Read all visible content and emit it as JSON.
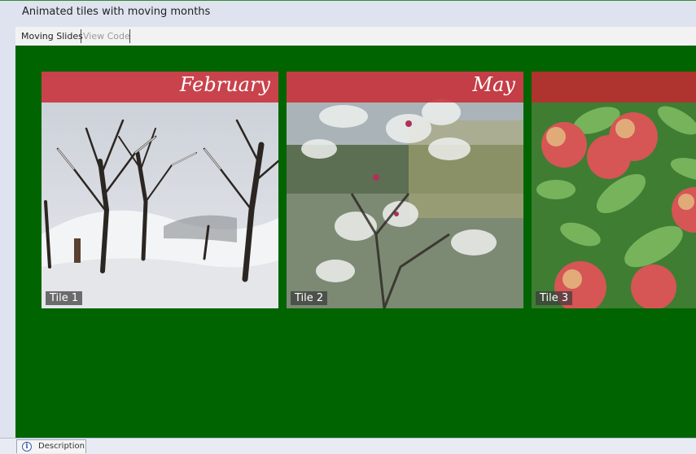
{
  "window": {
    "title": "Animated tiles with moving months"
  },
  "tabs": [
    {
      "label": "Moving Slides",
      "active": true
    },
    {
      "label": "View Code",
      "active": false
    }
  ],
  "stage": {
    "background": "#006400"
  },
  "tiles": [
    {
      "label": "Tile 1",
      "month": "February",
      "photo": "winter-trees"
    },
    {
      "label": "Tile 2",
      "month": "May",
      "photo": "apple-blossom"
    },
    {
      "label": "Tile 3",
      "month": "",
      "photo": "apples"
    }
  ],
  "footer": {
    "description_label": "Description",
    "icon": "info-icon"
  }
}
